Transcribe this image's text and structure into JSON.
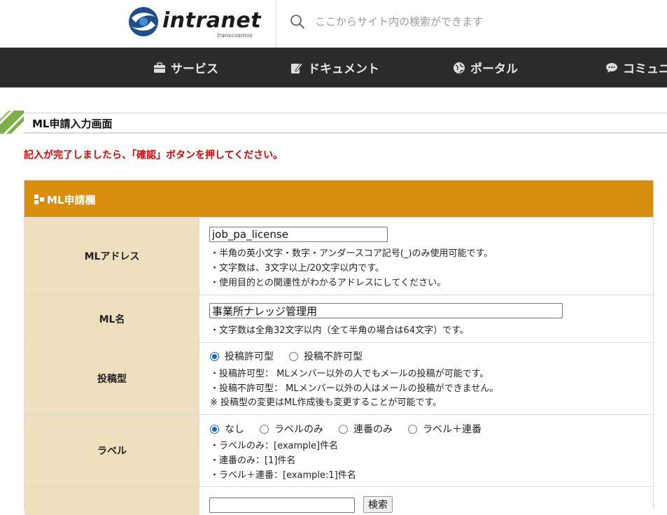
{
  "header": {
    "logo_text": "intranet",
    "logo_sub": "transcosmos",
    "search_placeholder": "ここからサイト内の検索ができます"
  },
  "nav": {
    "items": [
      {
        "label": "サービス",
        "icon": "briefcase-icon"
      },
      {
        "label": "ドキュメント",
        "icon": "document-edit-icon"
      },
      {
        "label": "ポータル",
        "icon": "globe-icon"
      },
      {
        "label": "コミュニ",
        "icon": "chat-icon"
      }
    ]
  },
  "page": {
    "title": "ML申請入力画面",
    "notice": "記入が完了しましたら、「確認」ボタンを押してください。"
  },
  "form": {
    "header": "ML申請欄",
    "rows": {
      "address": {
        "label": "MLアドレス",
        "value": "job_pa_license",
        "notes": [
          "・半角の英小文字・数字・アンダースコア記号(_)のみ使用可能です。",
          "・文字数は、3文字以上/20文字以内です。",
          "・使用目的との関連性がわかるアドレスにしてください。"
        ]
      },
      "name": {
        "label": "ML名",
        "value": "事業所ナレッジ管理用",
        "notes": [
          "・文字数は全角32文字以内（全て半角の場合は64文字）です。"
        ]
      },
      "post_type": {
        "label": "投稿型",
        "options": [
          "投稿許可型",
          "投稿不許可型"
        ],
        "selected": "投稿許可型",
        "notes": [
          "・投稿許可型： MLメンバー以外の人でもメールの投稿が可能です。",
          "・投稿不許可型： MLメンバー以外の人はメールの投稿ができません。",
          "※ 投稿型の変更はML作成後も変更することが可能です。"
        ]
      },
      "label_type": {
        "label": "ラベル",
        "options": [
          "なし",
          "ラベルのみ",
          "連番のみ",
          "ラベル＋連番"
        ],
        "selected": "なし",
        "notes": [
          "・ラベルのみ：[example]件名",
          "・連番のみ：[1]件名",
          "・ラベル＋連番：[example:1]件名"
        ]
      },
      "search_row": {
        "value": "",
        "button_label": "検索"
      }
    }
  },
  "colors": {
    "nav_bg": "#2b2b2b",
    "form_header_bg": "#d98e0e",
    "label_bg": "#f0dfbf",
    "notice_red": "#e00000",
    "radio_blue": "#0b69d4"
  }
}
